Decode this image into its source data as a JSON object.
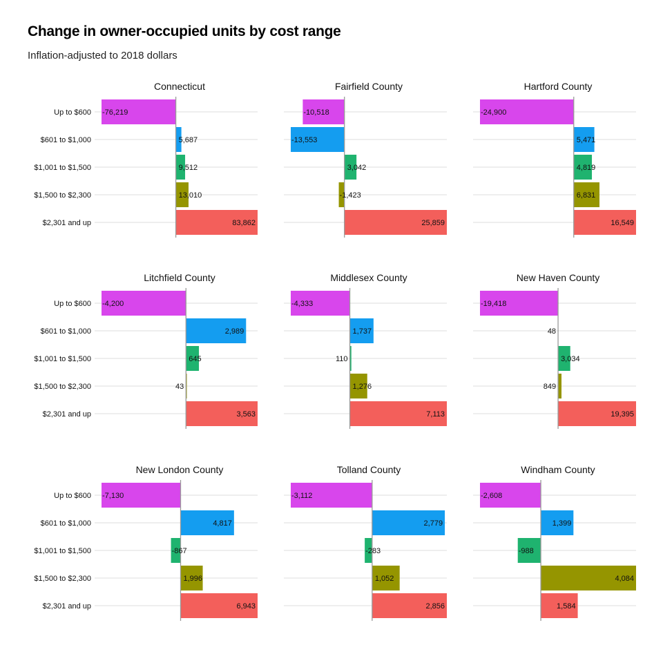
{
  "chart_data": {
    "type": "bar",
    "title": "Change in owner-occupied units by cost range",
    "subtitle": "Inflation-adjusted to 2018 dollars",
    "orientation": "horizontal",
    "categories": [
      "Up to $600",
      "$601 to $1,000",
      "$1,001 to $1,500",
      "$1,500 to $2,300",
      "$2,301 and up"
    ],
    "colors": [
      "#d846ec",
      "#149df0",
      "#1fb36f",
      "#959500",
      "#f35f5b"
    ],
    "facets": [
      {
        "name": "Connecticut",
        "values": [
          -76219,
          5687,
          9512,
          13010,
          83862
        ],
        "labels": [
          "-76,219",
          "5,687",
          "9,512",
          "13,010",
          "83,862"
        ]
      },
      {
        "name": "Fairfield County",
        "values": [
          -10518,
          -13553,
          3042,
          -1423,
          25859
        ],
        "labels": [
          "-10,518",
          "-13,553",
          "3,042",
          "-1,423",
          "25,859"
        ]
      },
      {
        "name": "Hartford County",
        "values": [
          -24900,
          5471,
          4819,
          6831,
          16549
        ],
        "labels": [
          "-24,900",
          "5,471",
          "4,819",
          "6,831",
          "16,549"
        ]
      },
      {
        "name": "Litchfield County",
        "values": [
          -4200,
          2989,
          645,
          43,
          3563
        ],
        "labels": [
          "-4,200",
          "2,989",
          "645",
          "43",
          "3,563"
        ]
      },
      {
        "name": "Middlesex County",
        "values": [
          -4333,
          1737,
          110,
          1276,
          7113
        ],
        "labels": [
          "-4,333",
          "1,737",
          "110",
          "1,276",
          "7,113"
        ]
      },
      {
        "name": "New Haven County",
        "values": [
          -19418,
          48,
          3034,
          849,
          19395
        ],
        "labels": [
          "-19,418",
          "48",
          "3,034",
          "849",
          "19,395"
        ]
      },
      {
        "name": "New London County",
        "values": [
          -7130,
          4817,
          -867,
          1996,
          6943
        ],
        "labels": [
          "-7,130",
          "4,817",
          "-867",
          "1,996",
          "6,943"
        ]
      },
      {
        "name": "Tolland County",
        "values": [
          -3112,
          2779,
          -283,
          1052,
          2856
        ],
        "labels": [
          "-3,112",
          "2,779",
          "-283",
          "1,052",
          "2,856"
        ]
      },
      {
        "name": "Windham County",
        "values": [
          -2608,
          1399,
          -988,
          4084,
          1584
        ],
        "labels": [
          "-2,608",
          "1,399",
          "-988",
          "4,084",
          "1,584"
        ]
      }
    ],
    "xscale": "free",
    "grid": true,
    "legend": "none"
  }
}
